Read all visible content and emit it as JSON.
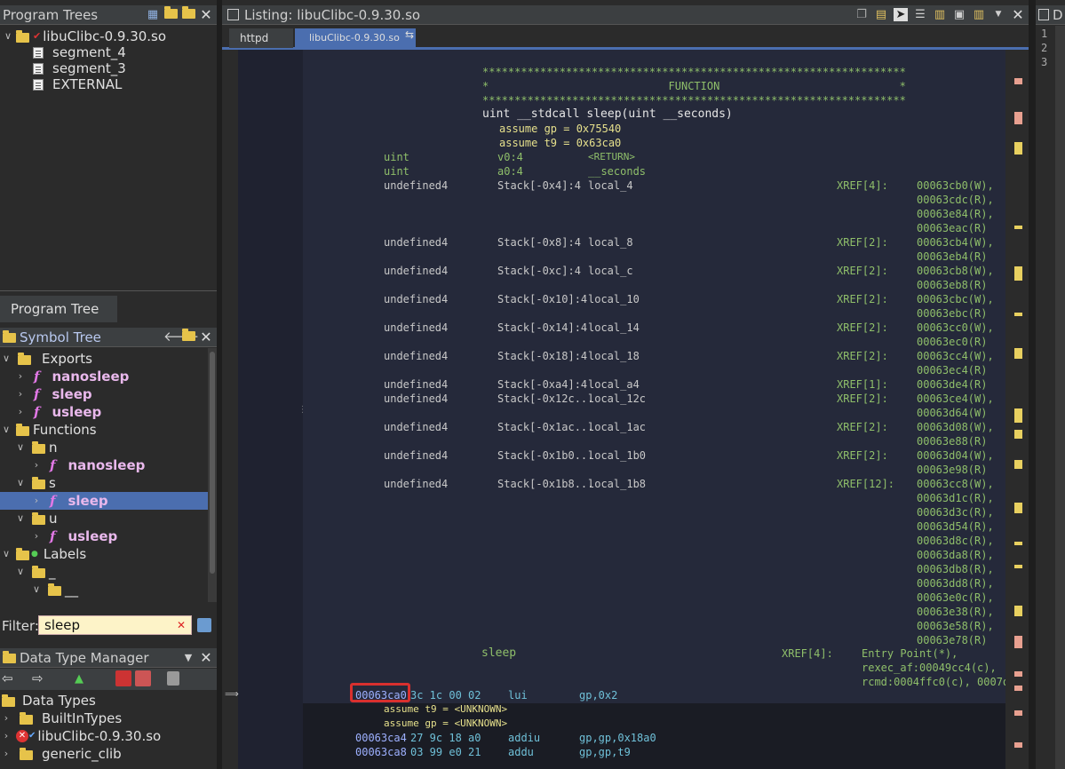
{
  "program_trees": {
    "title": "Program Trees",
    "root": "libuClibc-0.9.30.so",
    "items": [
      "segment_4",
      "segment_3",
      "EXTERNAL"
    ],
    "tab_label": "Program Tree"
  },
  "symbol_tree": {
    "title": "Symbol Tree",
    "exports_label": "Exports",
    "exports": [
      "nanosleep",
      "sleep",
      "usleep"
    ],
    "functions_label": "Functions",
    "fn_groups": [
      {
        "letter": "n",
        "fn": "nanosleep"
      },
      {
        "letter": "s",
        "fn": "sleep"
      },
      {
        "letter": "u",
        "fn": "usleep"
      }
    ],
    "labels_label": "Labels",
    "labels_sub1": "_",
    "labels_sub2": "__",
    "filter_label": "Filter:",
    "filter_value": "sleep"
  },
  "data_type_manager": {
    "title": "Data Type Manager",
    "root": "Data Types",
    "items": [
      "BuiltInTypes",
      "libuClibc-0.9.30.so",
      "generic_clib"
    ]
  },
  "listing": {
    "title": "Listing:  libuClibc-0.9.30.so",
    "tabs": [
      "httpd",
      "libuClibc-0.9.30.so"
    ],
    "stars": "******************************************************************",
    "banner": "*                            FUNCTION                            *",
    "signature": "uint __stdcall sleep(uint __seconds)",
    "assume1": "assume gp = 0x75540",
    "assume2": "assume t9 = 0x63ca0",
    "params": [
      {
        "type": "uint",
        "storage": "v0:4",
        "name": "<RETURN>"
      },
      {
        "type": "uint",
        "storage": "a0:4",
        "name": "__seconds"
      }
    ],
    "locals": [
      {
        "type": "undefined4",
        "storage": "Stack[-0x4]:4",
        "name": "local_4",
        "xref": "XREF[4]:",
        "refs": [
          "00063cb0(W),",
          "00063cdc(R),",
          "00063e84(R),",
          "00063eac(R)"
        ]
      },
      {
        "type": "undefined4",
        "storage": "Stack[-0x8]:4",
        "name": "local_8",
        "xref": "XREF[2]:",
        "refs": [
          "00063cb4(W),",
          "00063eb4(R)"
        ]
      },
      {
        "type": "undefined4",
        "storage": "Stack[-0xc]:4",
        "name": "local_c",
        "xref": "XREF[2]:",
        "refs": [
          "00063cb8(W),",
          "00063eb8(R)"
        ]
      },
      {
        "type": "undefined4",
        "storage": "Stack[-0x10]:4",
        "name": "local_10",
        "xref": "XREF[2]:",
        "refs": [
          "00063cbc(W),",
          "00063ebc(R)"
        ]
      },
      {
        "type": "undefined4",
        "storage": "Stack[-0x14]:4",
        "name": "local_14",
        "xref": "XREF[2]:",
        "refs": [
          "00063cc0(W),",
          "00063ec0(R)"
        ]
      },
      {
        "type": "undefined4",
        "storage": "Stack[-0x18]:4",
        "name": "local_18",
        "xref": "XREF[2]:",
        "refs": [
          "00063cc4(W),",
          "00063ec4(R)"
        ]
      },
      {
        "type": "undefined4",
        "storage": "Stack[-0xa4]:4",
        "name": "local_a4",
        "xref": "XREF[1]:",
        "refs": [
          "00063de4(R)"
        ]
      },
      {
        "type": "undefined4",
        "storage": "Stack[-0x12c...",
        "name": "local_12c",
        "xref": "XREF[2]:",
        "refs": [
          "00063ce4(W),",
          "00063d64(W)"
        ]
      },
      {
        "type": "undefined4",
        "storage": "Stack[-0x1ac...",
        "name": "local_1ac",
        "xref": "XREF[2]:",
        "refs": [
          "00063d08(W),",
          "00063e88(R)"
        ]
      },
      {
        "type": "undefined4",
        "storage": "Stack[-0x1b0...",
        "name": "local_1b0",
        "xref": "XREF[2]:",
        "refs": [
          "00063d04(W),",
          "00063e98(R)"
        ]
      },
      {
        "type": "undefined4",
        "storage": "Stack[-0x1b8...",
        "name": "local_1b8",
        "xref": "XREF[12]:",
        "refs": [
          "00063cc8(W),",
          "00063d1c(R),",
          "00063d3c(R),",
          "00063d54(R),",
          "00063d8c(R),",
          "00063da8(R),",
          "00063db8(R),",
          "00063dd8(R),",
          "00063e0c(R),",
          "00063e38(R),",
          "00063e58(R),",
          "00063e78(R)"
        ]
      }
    ],
    "func_label": "sleep",
    "func_xref": "XREF[4]:",
    "func_refs": [
      "Entry Point(*),",
      "rexec_af:00049cc4(c),",
      "rcmd:0004ffc0(c), 0007dl"
    ],
    "instructions": [
      {
        "addr": "00063ca0",
        "bytes": "3c 1c 00 02",
        "mnem": "lui",
        "ops": "gp,0x2"
      },
      {
        "addr": "00063ca4",
        "bytes": "27 9c 18 a0",
        "mnem": "addiu",
        "ops": "gp,gp,0x18a0"
      },
      {
        "addr": "00063ca8",
        "bytes": "03 99 e0 21",
        "mnem": "addu",
        "ops": "gp,gp,t9"
      }
    ],
    "assume_unk1": "assume t9 = <UNKNOWN>",
    "assume_unk2": "assume gp = <UNKNOWN>"
  },
  "right_panel": {
    "title": "D",
    "line_numbers": [
      "1",
      "2",
      "3"
    ]
  }
}
